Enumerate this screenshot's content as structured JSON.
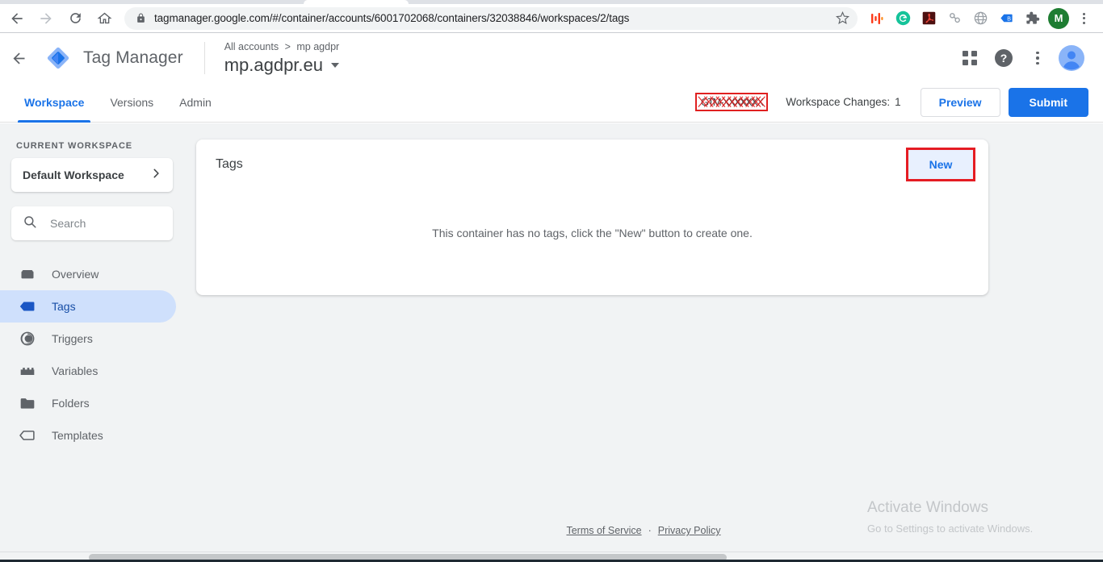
{
  "browser": {
    "url_visible": "tagmanager.google.com/#/container/accounts/6001702068/containers/32038846/workspaces/2/tags",
    "url_domain": "tagmanager.google.com",
    "url_path": "/#/container/accounts/6001702068/containers/32038846/workspaces/2/tags",
    "back_icon": "back-arrow-icon",
    "forward_icon": "forward-arrow-icon",
    "reload_icon": "reload-icon",
    "home_icon": "home-icon",
    "lock_icon": "lock-icon",
    "star_icon": "bookmark-star-icon",
    "profile_initial": "M",
    "extensions": [
      {
        "name": "extension-hotjar",
        "glyph": "|||"
      },
      {
        "name": "extension-grammarly",
        "glyph": "G"
      },
      {
        "name": "extension-adobe-acrobat",
        "glyph": "A"
      },
      {
        "name": "extension-chain",
        "glyph": "oo"
      },
      {
        "name": "extension-globe",
        "glyph": "globe"
      },
      {
        "name": "extension-tag-assistant",
        "glyph": "B"
      },
      {
        "name": "extension-puzzle",
        "glyph": "puzzle"
      }
    ]
  },
  "header": {
    "back_label": "back",
    "product_name": "Tag Manager",
    "breadcrumb_root": "All accounts",
    "breadcrumb_sep": ">",
    "breadcrumb_account": "mp agdpr",
    "container_name": "mp.agdpr.eu",
    "apps_icon": "apps-grid-icon",
    "help_icon": "help-circle-icon",
    "more_icon": "more-vert-icon",
    "avatar_icon": "user-avatar-icon"
  },
  "navbar": {
    "tabs": [
      {
        "label": "Workspace",
        "active": true
      },
      {
        "label": "Versions",
        "active": false
      },
      {
        "label": "Admin",
        "active": false
      }
    ],
    "container_id": "GTM-XXXXXXX",
    "container_id_redacted": true,
    "workspace_changes_label": "Workspace Changes:",
    "workspace_changes_count": "1",
    "preview_label": "Preview",
    "submit_label": "Submit",
    "accent_color": "#1a73e8",
    "highlight_color": "#e02020"
  },
  "sidebar": {
    "section_label": "CURRENT WORKSPACE",
    "workspace_name": "Default Workspace",
    "workspace_chevron_icon": "chevron-right-icon",
    "search_placeholder": "Search",
    "search_value": "",
    "search_icon": "search-icon",
    "items": [
      {
        "label": "Overview",
        "icon": "overview-box-icon",
        "active": false
      },
      {
        "label": "Tags",
        "icon": "tag-icon",
        "active": true
      },
      {
        "label": "Triggers",
        "icon": "trigger-circle-icon",
        "active": false
      },
      {
        "label": "Variables",
        "icon": "variables-icon",
        "active": false
      },
      {
        "label": "Folders",
        "icon": "folder-icon",
        "active": false
      },
      {
        "label": "Templates",
        "icon": "template-tag-icon",
        "active": false
      }
    ],
    "active_bg": "#cfe0fc",
    "active_fg": "#174ea6"
  },
  "main": {
    "card_title": "Tags",
    "new_button_label": "New",
    "new_button_highlighted": true,
    "empty_message": "This container has no tags, click the \"New\" button to create one.",
    "annotation_arrow_icon": "red-arrow-left-icon"
  },
  "footer": {
    "terms_label": "Terms of Service",
    "separator": "·",
    "privacy_label": "Privacy Policy"
  },
  "watermark": {
    "title": "Activate Windows",
    "subtitle": "Go to Settings to activate Windows."
  }
}
